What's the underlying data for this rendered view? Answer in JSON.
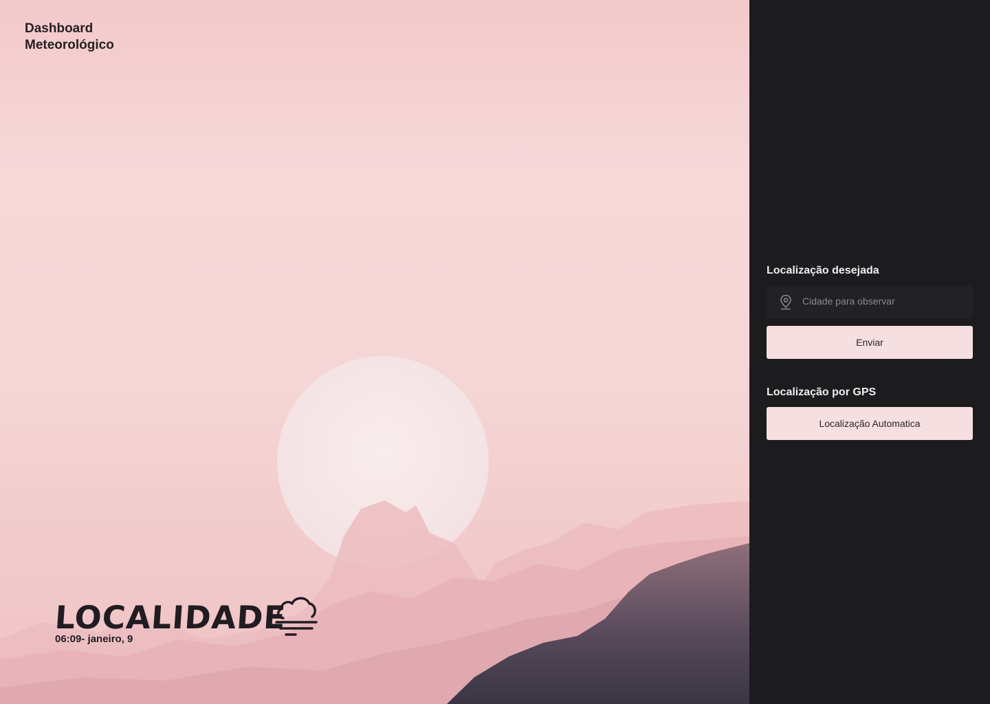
{
  "app": {
    "title": "Dashboard\nMeteorológico"
  },
  "hero": {
    "location": "LOCALIDADE",
    "datetime": "06:09- janeiro, 9",
    "weather_icon": "cloud-fog-icon"
  },
  "sidebar": {
    "search_label": "Localização desejada",
    "search_placeholder": "Cidade para observar",
    "search_value": "",
    "submit_label": "Enviar",
    "gps_label": "Localização por GPS",
    "gps_button_label": "Localização Automatica"
  },
  "colors": {
    "panel_bg": "#1c1b1e",
    "button_bg": "#f6dfe0",
    "hero_pink": "#f3c9cb",
    "text_dark": "#201c22"
  }
}
